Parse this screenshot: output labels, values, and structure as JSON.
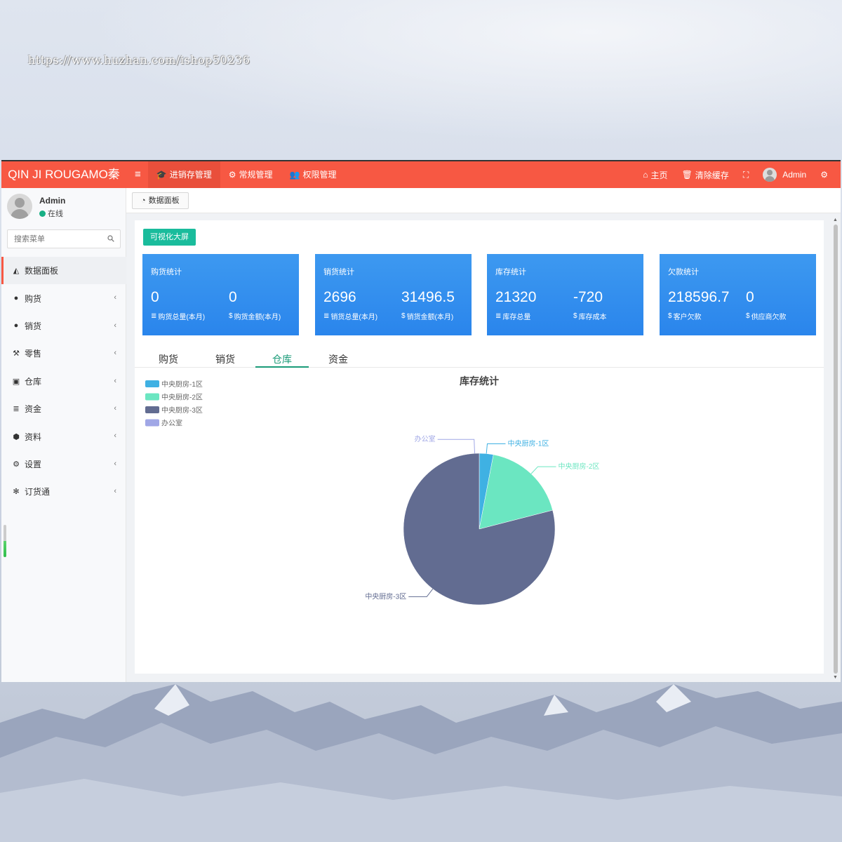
{
  "watermark": "https://www.huzhan.com/ishop50236",
  "topbar": {
    "logo": "QIN JI ROUGAMO秦",
    "nav": [
      {
        "label": "进销存管理",
        "icon": "graduation-cap-icon"
      },
      {
        "label": "常规管理",
        "icon": "cogs-icon"
      },
      {
        "label": "权限管理",
        "icon": "users-icon"
      }
    ],
    "right": {
      "home": "主页",
      "clear_cache": "清除缓存",
      "user": "Admin"
    }
  },
  "sidebar": {
    "user": {
      "name": "Admin",
      "status": "在线"
    },
    "search": {
      "placeholder": "搜索菜单"
    },
    "items": [
      {
        "label": "数据面板",
        "icon": "area-chart-icon",
        "active": true
      },
      {
        "label": "购货",
        "icon": "github-icon"
      },
      {
        "label": "销货",
        "icon": "apple-icon"
      },
      {
        "label": "零售",
        "icon": "gavel-icon"
      },
      {
        "label": "仓库",
        "icon": "cc-icon"
      },
      {
        "label": "资金",
        "icon": "database-icon"
      },
      {
        "label": "资料",
        "icon": "cubes-icon"
      },
      {
        "label": "设置",
        "icon": "cogs-icon"
      },
      {
        "label": "订货通",
        "icon": "yelp-icon"
      }
    ]
  },
  "tabbar": {
    "tab": "数据面板"
  },
  "main": {
    "visual_button": "可视化大屏",
    "cards": [
      {
        "title": "购货统计",
        "v1": "0",
        "l1": "购货总量(本月)",
        "v2": "0",
        "l2": "购货金额(本月)"
      },
      {
        "title": "销货统计",
        "v1": "2696",
        "l1": "销货总量(本月)",
        "v2": "31496.5",
        "l2": "销货金额(本月)"
      },
      {
        "title": "库存统计",
        "v1": "21320",
        "l1": "库存总量",
        "v2": "-720",
        "l2": "库存成本"
      },
      {
        "title": "欠款统计",
        "v1": "218596.7",
        "l1": "客户欠款",
        "v2": "0",
        "l2": "供应商欠款"
      }
    ],
    "tabs": [
      "购货",
      "销货",
      "仓库",
      "资金"
    ],
    "active_tab": 2
  },
  "colors": {
    "topbar": "#f75843",
    "card": "#2a85ec",
    "accent": "#1a9b78"
  },
  "chart_data": {
    "type": "pie",
    "title": "库存统计",
    "categories": [
      "中央厨房-1区",
      "中央厨房-2区",
      "中央厨房-3区",
      "办公室"
    ],
    "values": [
      3,
      18,
      79,
      0
    ],
    "colors": [
      "#3fb1e3",
      "#6be6c1",
      "#626c91",
      "#a0a7e6"
    ],
    "legend": "top-left"
  }
}
